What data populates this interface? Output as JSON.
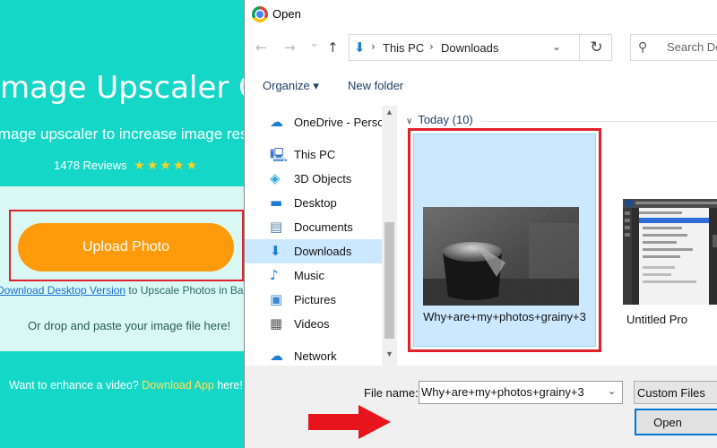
{
  "webpage": {
    "title": "Image Upscaler O",
    "subtitle": "image upscaler to increase image reso",
    "reviews_text": "1478 Reviews",
    "stars": "★★★★★",
    "upload_label": "Upload Photo",
    "download_link": "Download Desktop Version",
    "download_rest": " to Upscale Photos in Ba",
    "drop_text": "Or drop and paste your image file here!",
    "footer_text": "Want to enhance a video? ",
    "footer_link": "Download App",
    "footer_rest": " here!"
  },
  "dialog": {
    "title": "Open",
    "nav": {
      "back_icon": "←",
      "forward_icon": "→",
      "recent_icon": "⌄",
      "up_icon": "↑"
    },
    "address": {
      "crumbs": [
        "This PC",
        "Downloads"
      ],
      "separator": "›",
      "drop_icon": "⌄",
      "refresh_icon": "↻"
    },
    "search": {
      "placeholder": "Search Do",
      "icon": "⚲"
    },
    "toolbar": {
      "organize": "Organize ▾",
      "new_folder": "New folder"
    },
    "nav_pane": {
      "items": [
        {
          "label": "OneDrive - Persona",
          "icon": "☁",
          "color": "#1c7ed6"
        },
        {
          "label": "This PC",
          "icon": "🖳",
          "color": "#3a78c4"
        },
        {
          "label": "3D Objects",
          "icon": "◈",
          "color": "#2aa3d8"
        },
        {
          "label": "Desktop",
          "icon": "▬",
          "color": "#1c7ed6"
        },
        {
          "label": "Documents",
          "icon": "▤",
          "color": "#5a7fa8"
        },
        {
          "label": "Downloads",
          "icon": "⬇",
          "color": "#1c7ed6"
        },
        {
          "label": "Music",
          "icon": "♪",
          "color": "#1c7ed6"
        },
        {
          "label": "Pictures",
          "icon": "▣",
          "color": "#3a8ad0"
        },
        {
          "label": "Videos",
          "icon": "▦",
          "color": "#5a5a5a"
        },
        {
          "label": "Network",
          "icon": "☁",
          "color": "#1c7ed6"
        }
      ],
      "selected_index": 5
    },
    "file_pane": {
      "group_label": "Today (10)",
      "group_chevron": "∨",
      "files": [
        {
          "name": "Why+are+my+photos+grainy+3"
        },
        {
          "name": "Untitled Pro"
        }
      ]
    },
    "bottom": {
      "file_name_label": "File name:",
      "file_name_value": "Why+are+my+photos+grainy+3",
      "dropdown_icon": "⌄",
      "file_type": "Custom Files",
      "open_label": "Open"
    }
  }
}
